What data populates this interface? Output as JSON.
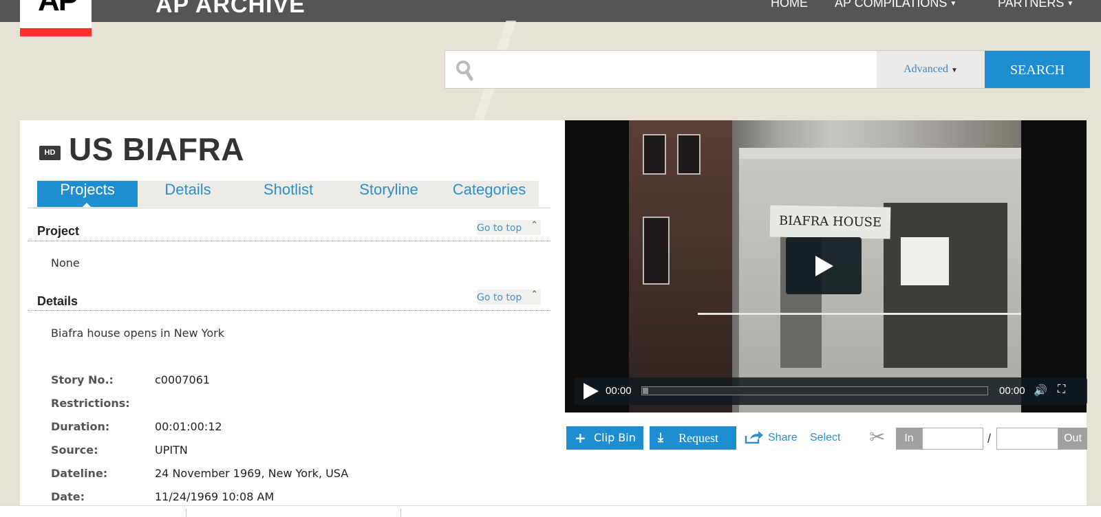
{
  "header": {
    "logo_text": "AP",
    "brand": "AP ARCHIVE",
    "nav": [
      {
        "label": "HOME",
        "caret": false
      },
      {
        "label": "AP COMPILATIONS",
        "caret": true
      },
      {
        "label": "PARTNERS",
        "caret": true
      }
    ]
  },
  "search": {
    "placeholder": "",
    "advanced_label": "Advanced",
    "button_label": "SEARCH"
  },
  "story": {
    "badge": "HD",
    "title": "US BIAFRA",
    "tabs": [
      "Projects",
      "Details",
      "Shotlist",
      "Storyline",
      "Categories"
    ],
    "active_tab": "Projects",
    "sections": {
      "project": {
        "heading": "Project",
        "go_to_top": "Go to top",
        "value": "None"
      },
      "details": {
        "heading": "Details",
        "go_to_top": "Go to top",
        "summary": "Biafra house opens in New York"
      }
    },
    "meta": [
      {
        "label": "Story No.:",
        "value": "c0007061"
      },
      {
        "label": "Restrictions:",
        "value": ""
      },
      {
        "label": "Duration:",
        "value": "00:01:00:12"
      },
      {
        "label": "Source:",
        "value": "UPITN"
      },
      {
        "label": "Dateline:",
        "value": "24 November 1969, New York, USA"
      },
      {
        "label": "Date:",
        "value": "11/24/1969 10:08 AM"
      }
    ]
  },
  "video": {
    "sign_text": "BIAFRA HOUSE",
    "current_time": "00:00",
    "duration": "00:00",
    "progress": 0
  },
  "actions": {
    "clip_bin": "Clip Bin",
    "request": "Request",
    "share": "Share",
    "select": "Select",
    "in_label": "In",
    "out_label": "Out",
    "separator": "/"
  }
}
